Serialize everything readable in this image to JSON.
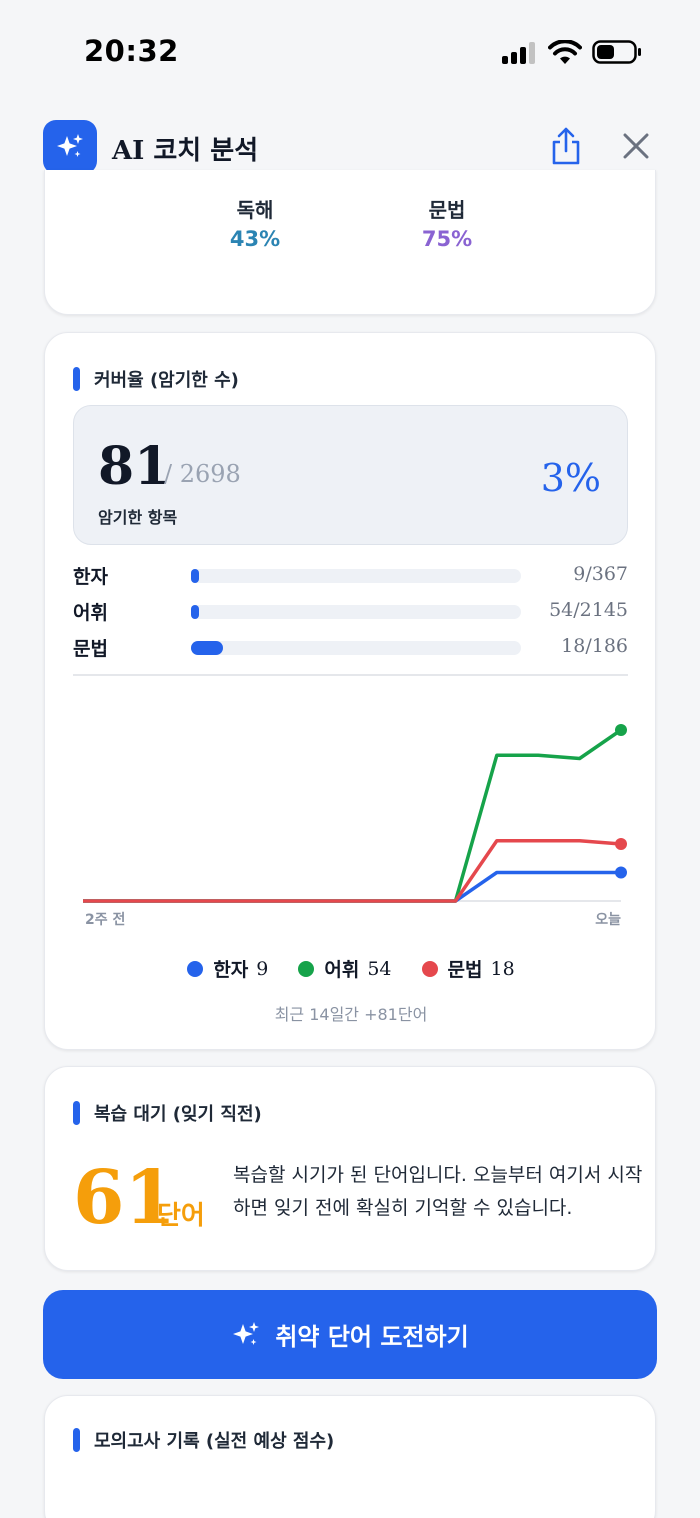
{
  "status_bar": {
    "time": "20:32"
  },
  "header": {
    "title": "AI 코치 분석"
  },
  "scores": [
    {
      "label": "독해",
      "value": "43%",
      "color": "#2b84b3"
    },
    {
      "label": "문법",
      "value": "75%",
      "color": "#8a63d2"
    }
  ],
  "coverage": {
    "title": "커버율 (암기한 수)",
    "memorized": "81",
    "total": "/ 2698",
    "sub_label": "암기한 항목",
    "percent": "3%",
    "rows": [
      {
        "label": "한자",
        "value": "9/367",
        "progress": 0.025
      },
      {
        "label": "어휘",
        "value": "54/2145",
        "progress": 0.025
      },
      {
        "label": "문법",
        "value": "18/186",
        "progress": 0.097
      }
    ],
    "axis_left": "2주 전",
    "axis_right": "오늘",
    "legend": [
      {
        "label": "한자",
        "count": "9",
        "color": "#2563eb"
      },
      {
        "label": "어휘",
        "count": "54",
        "color": "#16a34a"
      },
      {
        "label": "문법",
        "count": "18",
        "color": "#e5484d"
      }
    ],
    "recent_text": "최근 14일간 +81단어"
  },
  "chart_data": {
    "type": "line",
    "x": [
      1,
      2,
      3,
      4,
      5,
      6,
      7,
      8,
      9,
      10,
      11,
      12,
      13,
      14
    ],
    "series": [
      {
        "name": "한자",
        "color": "#2563eb",
        "values": [
          0,
          0,
          0,
          0,
          0,
          0,
          0,
          0,
          0,
          0,
          9,
          9,
          9,
          9
        ]
      },
      {
        "name": "어휘",
        "color": "#16a34a",
        "values": [
          0,
          0,
          0,
          0,
          0,
          0,
          0,
          0,
          0,
          0,
          46,
          46,
          45,
          54
        ]
      },
      {
        "name": "문법",
        "color": "#e5484d",
        "values": [
          0,
          0,
          0,
          0,
          0,
          0,
          0,
          0,
          0,
          0,
          19,
          19,
          19,
          18
        ]
      }
    ],
    "ylim": [
      0,
      60
    ]
  },
  "review": {
    "title": "복습 대기 (잊기 직전)",
    "count": "61",
    "unit": "단어",
    "description": "복습할 시기가 된 단어입니다. 오늘부터 여기서 시작하면 잊기 전에 확실히 기억할 수 있습니다."
  },
  "cta": {
    "label": "취약 단어 도전하기"
  },
  "mock": {
    "title": "모의고사 기록 (실전 예상 점수)"
  }
}
